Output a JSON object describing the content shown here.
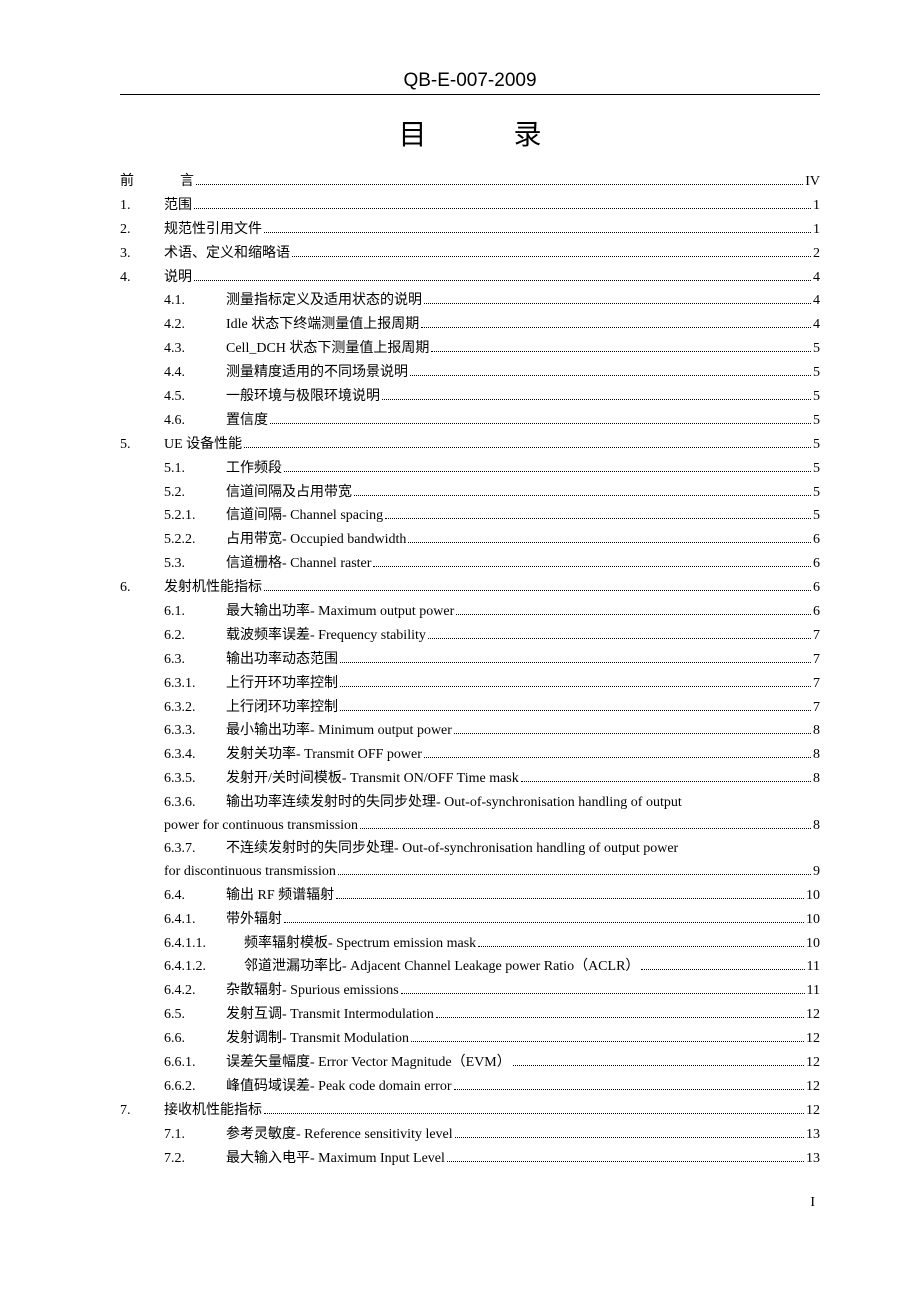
{
  "doc_id": "QB-E-007-2009",
  "toc_title": "目  录",
  "page_number": "I",
  "entries": [
    {
      "lvl": 0,
      "num": "前",
      "label": "言",
      "page": "IV",
      "special_pad": true
    },
    {
      "lvl": 0,
      "num": "1.",
      "label": "范围",
      "page": "1"
    },
    {
      "lvl": 0,
      "num": "2.",
      "label": "规范性引用文件",
      "page": "1"
    },
    {
      "lvl": 0,
      "num": "3.",
      "label": "术语、定义和缩略语",
      "page": "2"
    },
    {
      "lvl": 0,
      "num": "4.",
      "label": "说明",
      "page": "4"
    },
    {
      "lvl": 1,
      "num": "4.1.",
      "label": "测量指标定义及适用状态的说明",
      "page": "4"
    },
    {
      "lvl": 1,
      "num": "4.2.",
      "label": "Idle 状态下终端测量值上报周期",
      "page": "4"
    },
    {
      "lvl": 1,
      "num": "4.3.",
      "label": "Cell_DCH 状态下测量值上报周期",
      "page": "5"
    },
    {
      "lvl": 1,
      "num": "4.4.",
      "label": "测量精度适用的不同场景说明",
      "page": "5"
    },
    {
      "lvl": 1,
      "num": "4.5.",
      "label": "一般环境与极限环境说明",
      "page": "5"
    },
    {
      "lvl": 1,
      "num": "4.6.",
      "label": "置信度",
      "page": "5"
    },
    {
      "lvl": 0,
      "num": "5.",
      "label": "UE 设备性能",
      "page": "5"
    },
    {
      "lvl": 1,
      "num": "5.1.",
      "label": "工作频段",
      "page": "5"
    },
    {
      "lvl": 1,
      "num": "5.2.",
      "label": "信道间隔及占用带宽",
      "page": "5"
    },
    {
      "lvl": 2,
      "num": "5.2.1.",
      "label": "信道间隔- Channel spacing",
      "page": "5"
    },
    {
      "lvl": 2,
      "num": "5.2.2.",
      "label": "占用带宽- Occupied bandwidth",
      "page": "6"
    },
    {
      "lvl": 1,
      "num": "5.3.",
      "label": "信道栅格- Channel raster",
      "page": "6"
    },
    {
      "lvl": 0,
      "num": "6.",
      "label": "发射机性能指标",
      "page": "6"
    },
    {
      "lvl": 1,
      "num": "6.1.",
      "label": "最大输出功率- Maximum output power",
      "page": "6"
    },
    {
      "lvl": 1,
      "num": "6.2.",
      "label": "载波频率误差- Frequency stability",
      "page": "7"
    },
    {
      "lvl": 1,
      "num": "6.3.",
      "label": "输出功率动态范围",
      "page": "7"
    },
    {
      "lvl": 2,
      "num": "6.3.1.",
      "label": "上行开环功率控制",
      "page": "7"
    },
    {
      "lvl": 2,
      "num": "6.3.2.",
      "label": "上行闭环功率控制",
      "page": "7"
    },
    {
      "lvl": 2,
      "num": "6.3.3.",
      "label": "最小输出功率- Minimum output power",
      "page": "8"
    },
    {
      "lvl": 2,
      "num": "6.3.4.",
      "label": "发射关功率- Transmit OFF power",
      "page": "8"
    },
    {
      "lvl": 2,
      "num": "6.3.5.",
      "label": "发射开/关时间模板- Transmit ON/OFF Time mask",
      "page": "8"
    },
    {
      "wrap": true,
      "lvl": 2,
      "num": "6.3.6.",
      "label_line1": "输出功率连续发射时的失同步处理- Out-of-synchronisation handling of output",
      "label_line2": "power for continuous transmission",
      "page": "8"
    },
    {
      "wrap": true,
      "lvl": 2,
      "num": "6.3.7.",
      "label_line1": "不连续发射时的失同步处理- Out-of-synchronisation handling of output power",
      "label_line2": "for discontinuous transmission",
      "page": "9"
    },
    {
      "lvl": 1,
      "num": "6.4.",
      "label": "输出 RF 频谱辐射",
      "page": "10"
    },
    {
      "lvl": 2,
      "num": "6.4.1.",
      "label": "带外辐射",
      "page": "10"
    },
    {
      "lvl": 3,
      "num": "6.4.1.1.",
      "label": "频率辐射模板- Spectrum emission mask",
      "page": "10"
    },
    {
      "lvl": 3,
      "num": "6.4.1.2.",
      "label": "邻道泄漏功率比- Adjacent Channel Leakage power Ratio（ACLR）",
      "page": "11"
    },
    {
      "lvl": 2,
      "num": "6.4.2.",
      "label": "杂散辐射- Spurious emissions",
      "page": "11"
    },
    {
      "lvl": 1,
      "num": "6.5.",
      "label": "发射互调- Transmit Intermodulation",
      "page": "12"
    },
    {
      "lvl": 1,
      "num": "6.6.",
      "label": "发射调制- Transmit Modulation",
      "page": "12"
    },
    {
      "lvl": 2,
      "num": "6.6.1.",
      "label": "误差矢量幅度- Error Vector Magnitude（EVM）",
      "page": "12"
    },
    {
      "lvl": 2,
      "num": "6.6.2.",
      "label": "峰值码域误差- Peak code domain error",
      "page": "12"
    },
    {
      "lvl": 0,
      "num": "7.",
      "label": "接收机性能指标",
      "page": "12"
    },
    {
      "lvl": 1,
      "num": "7.1.",
      "label": "参考灵敏度- Reference sensitivity level",
      "page": "13"
    },
    {
      "lvl": 1,
      "num": "7.2.",
      "label": "最大输入电平- Maximum Input Level",
      "page": "13"
    }
  ]
}
